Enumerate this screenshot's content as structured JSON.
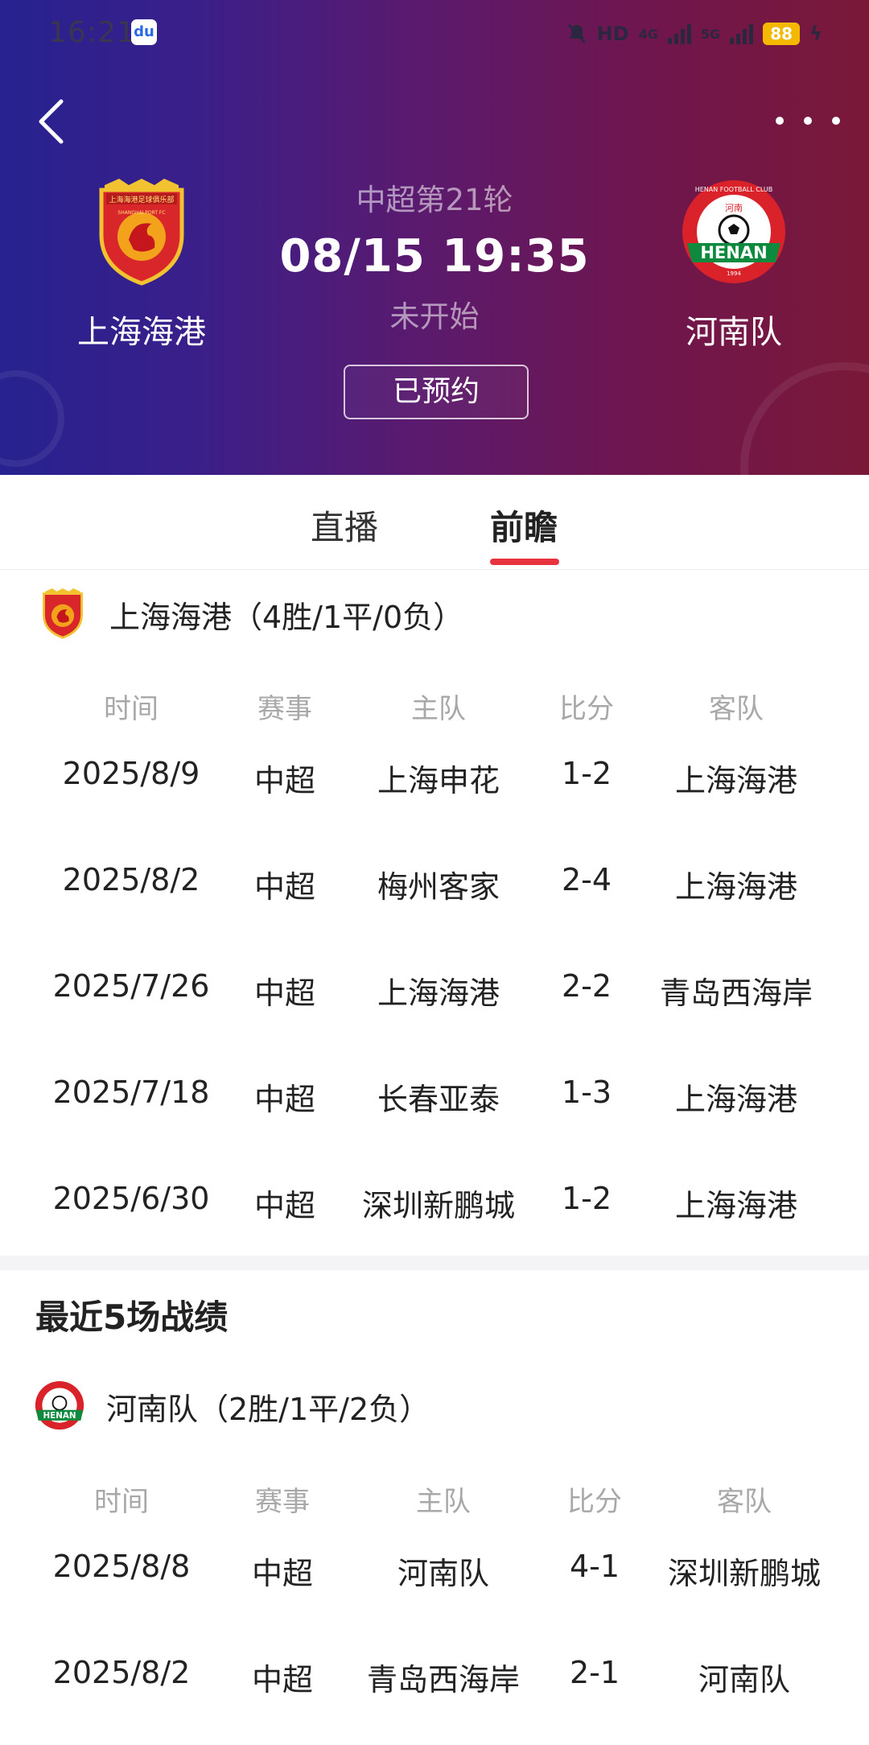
{
  "status_bar": {
    "time": "16:21",
    "app_icon": "baidu-paw-icon",
    "hd_label": "HD",
    "net1": "4G",
    "net2": "5G",
    "battery": "88"
  },
  "header": {
    "home_team": "上海海港",
    "away_team": "河南队",
    "round": "中超第21轮",
    "datetime": "08/15 19:35",
    "state": "未开始",
    "reserve_label": "已预约",
    "home_logo": {
      "top_text": "上海海港足球俱乐部",
      "bottom_text": "SHANGHAI PORT FC"
    },
    "away_logo": {
      "arc_text": "HENAN FOOTBALL CLUB",
      "top_text": "河南",
      "banner_text": "HENAN",
      "year": "1994"
    },
    "colors": {
      "gradient_start": "#26228f",
      "gradient_end": "#7a1838"
    }
  },
  "tabs": [
    {
      "label": "直播"
    },
    {
      "label": "前瞻",
      "active": true
    }
  ],
  "accent_color": "#e8333f",
  "columns": [
    "时间",
    "赛事",
    "主队",
    "比分",
    "客队"
  ],
  "section1": {
    "title": "上海海港（4胜/1平/0负）",
    "rows": [
      [
        "2025/8/9",
        "中超",
        "上海申花",
        "1-2",
        "上海海港"
      ],
      [
        "2025/8/2",
        "中超",
        "梅州客家",
        "2-4",
        "上海海港"
      ],
      [
        "2025/7/26",
        "中超",
        "上海海港",
        "2-2",
        "青岛西海岸"
      ],
      [
        "2025/7/18",
        "中超",
        "长春亚泰",
        "1-3",
        "上海海港"
      ],
      [
        "2025/6/30",
        "中超",
        "深圳新鹏城",
        "1-2",
        "上海海港"
      ]
    ]
  },
  "section2": {
    "heading": "最近5场战绩",
    "title": "河南队（2胜/1平/2负）",
    "rows": [
      [
        "2025/8/8",
        "中超",
        "河南队",
        "4-1",
        "深圳新鹏城"
      ],
      [
        "2025/8/2",
        "中超",
        "青岛西海岸",
        "2-1",
        "河南队"
      ]
    ]
  }
}
